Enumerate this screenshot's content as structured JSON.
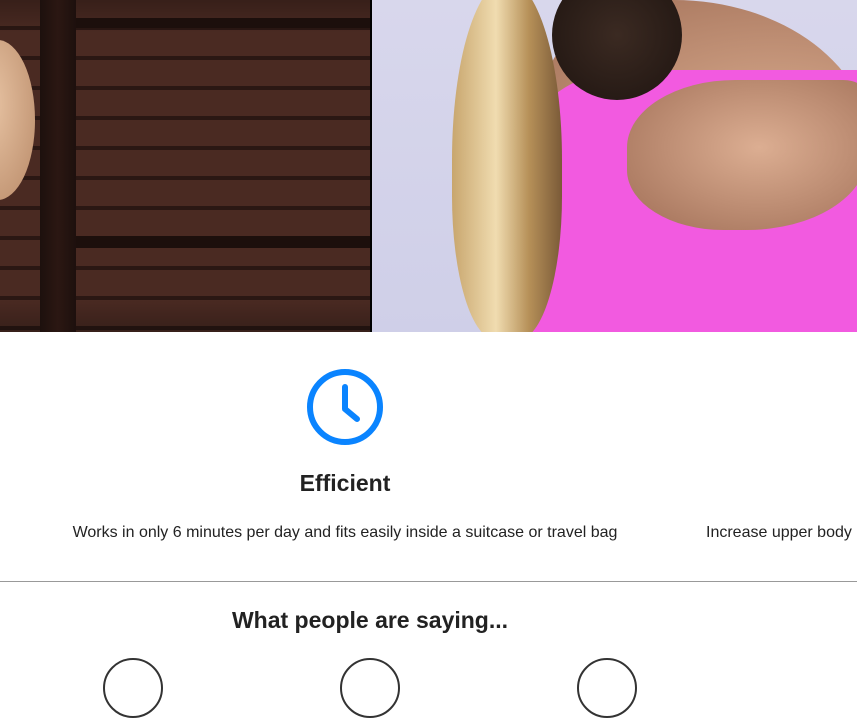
{
  "feature": {
    "icon": "clock-icon",
    "icon_color": "#0a84ff",
    "title": "Efficient",
    "description": "Works in only 6 minutes per day and fits easily inside a suitcase or travel bag",
    "next_description": "Increase upper body"
  },
  "testimonials": {
    "title": "What people are saying..."
  }
}
